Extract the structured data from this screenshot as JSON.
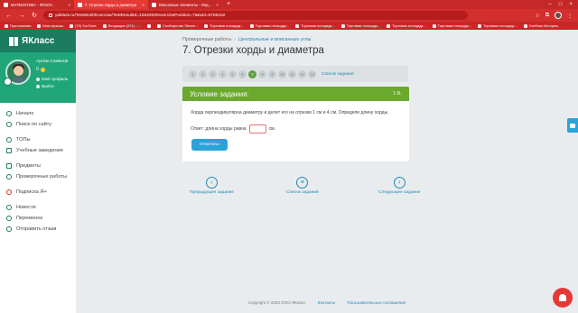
{
  "browser": {
    "tabs": [
      {
        "label": "МАТЕМАТИКА - ФГБОУ...",
        "active": false
      },
      {
        "label": "7. Отрезки хорды и диаметра",
        "active": true
      },
      {
        "label": "Вписанные Элементы - Яндекс...",
        "active": false
      }
    ],
    "url": "yaklass.ru/TestWork/Exercise/TestResultId=1264293#exercisePosition=7&twId=5785152",
    "bookmarks": [
      "Приложения",
      "Моя музыка",
      "(79) YouTube",
      "Входящие (221) - ...",
      "",
      "Сообщество Steam ::",
      "Торговая площадк...",
      "Торговая площадк...",
      "Торговая площадк...",
      "Торговая площадк...",
      "Торговая площадк...",
      "Торговая площадк...",
      "Торговая площадк...",
      "Учебник История..."
    ]
  },
  "sidebar": {
    "logo": "ЯКласс",
    "profile": {
      "name": "Артём Семёнов",
      "coins": "0",
      "my_profile": "Мой профиль",
      "logout": "Выйти"
    },
    "menu": [
      {
        "label": "Начало"
      },
      {
        "label": "Поиск по сайту"
      },
      {
        "label": "ТОПы"
      },
      {
        "label": "Учебные заведения"
      },
      {
        "label": "Предметы"
      },
      {
        "label": "Проверочные работы"
      },
      {
        "label": "Подписка Я+"
      },
      {
        "label": "Новости"
      },
      {
        "label": "Переменка"
      },
      {
        "label": "Отправить отзыв"
      }
    ]
  },
  "main": {
    "breadcrumb": {
      "first": "Проверочные работы",
      "second": "Центральные и вписанные углы"
    },
    "title": "7. Отрезки хорды и диаметра",
    "pager": {
      "pages": [
        "1",
        "2",
        "3",
        "4",
        "5",
        "6",
        "7",
        "8",
        "9",
        "10",
        "11",
        "12",
        "13"
      ],
      "current": "7",
      "all_tasks": "Список заданий"
    },
    "task": {
      "header": "Условие задания:",
      "points": "1 Б.",
      "text": "Хорда перпендикулярна диаметру и делит его на отрезки 1 см и 4 см. Определи длину хорды.",
      "answer_prefix": "Ответ: длина хорды равна",
      "answer_unit": "см.",
      "answer_value": "",
      "submit": "Ответить!"
    },
    "nav": {
      "prev": "Предыдущее задание",
      "list": "Список заданий",
      "next": "Следующее задание"
    },
    "footer": {
      "copyright": "Copyright © 2020 ООО ЯКласс",
      "contacts": "Контакты",
      "agreement": "Пользовательское соглашение"
    }
  }
}
